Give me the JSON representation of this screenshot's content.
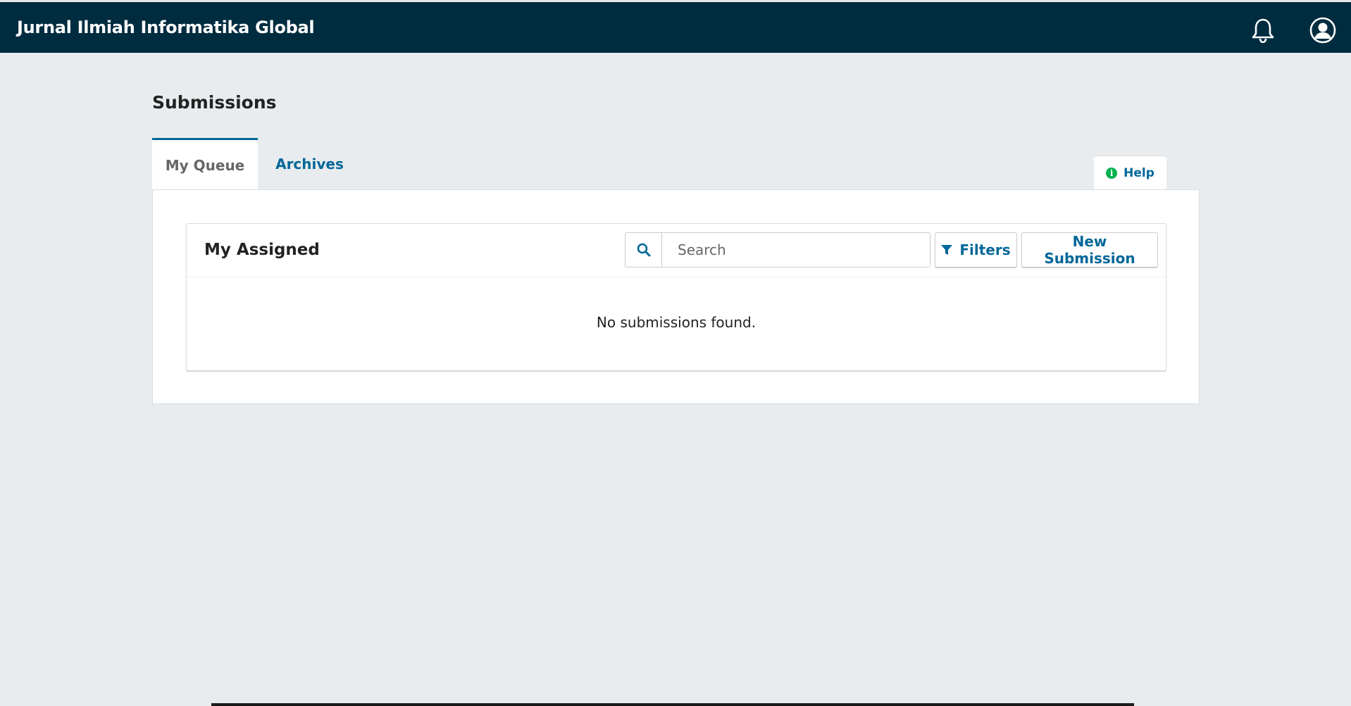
{
  "header": {
    "site_title": "Jurnal Ilmiah Informatika Global",
    "notifications_icon": "bell-icon",
    "user_icon": "user-circle-icon",
    "background_color": "#002c40"
  },
  "page": {
    "title": "Submissions"
  },
  "tabs": [
    {
      "label": "My Queue",
      "active": true
    },
    {
      "label": "Archives",
      "active": false
    }
  ],
  "help": {
    "label": "Help",
    "icon": "info-icon",
    "icon_color": "#00b24e"
  },
  "list": {
    "title": "My Assigned",
    "search_placeholder": "Search",
    "search_icon": "search-icon",
    "filters_label": "Filters",
    "filters_icon": "filter-icon",
    "new_submission_label": "New Submission",
    "empty_message": "No submissions found."
  },
  "colors": {
    "accent": "#006798",
    "page_background": "#e9ecee"
  }
}
